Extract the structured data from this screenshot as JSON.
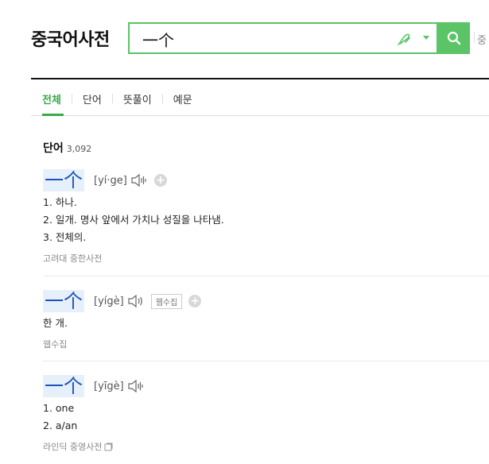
{
  "header": {
    "brand": "중국어사전",
    "search_value": "一个",
    "cut_text": "중"
  },
  "tabs": [
    "전체",
    "단어",
    "뜻풀이",
    "예문"
  ],
  "section": {
    "title": "단어",
    "count": "3,092"
  },
  "entries": [
    {
      "hanzi": "一个",
      "pinyin": "[yí·ge]",
      "lines": [
        "1. 하나.",
        "2. 일개. 명사 앞에서 가치나 성질을 나타냄.",
        "3. 전체의."
      ],
      "source": "고려대 중한사전"
    },
    {
      "hanzi": "一个",
      "pinyin": "[yígè]",
      "badge": "웹수집",
      "lines": [
        "한 개."
      ],
      "source": "웹수집"
    },
    {
      "hanzi": "一个",
      "pinyin": "[yīgè]",
      "lines": [
        "1. one",
        "2. a/an"
      ],
      "source": "라인딕 중영사전"
    }
  ],
  "colors": {
    "accent": "#5ac466",
    "tab_active": "#3aa84a",
    "hanzi": "#1f52b8",
    "hanzi_bg": "#e6f0fb"
  }
}
